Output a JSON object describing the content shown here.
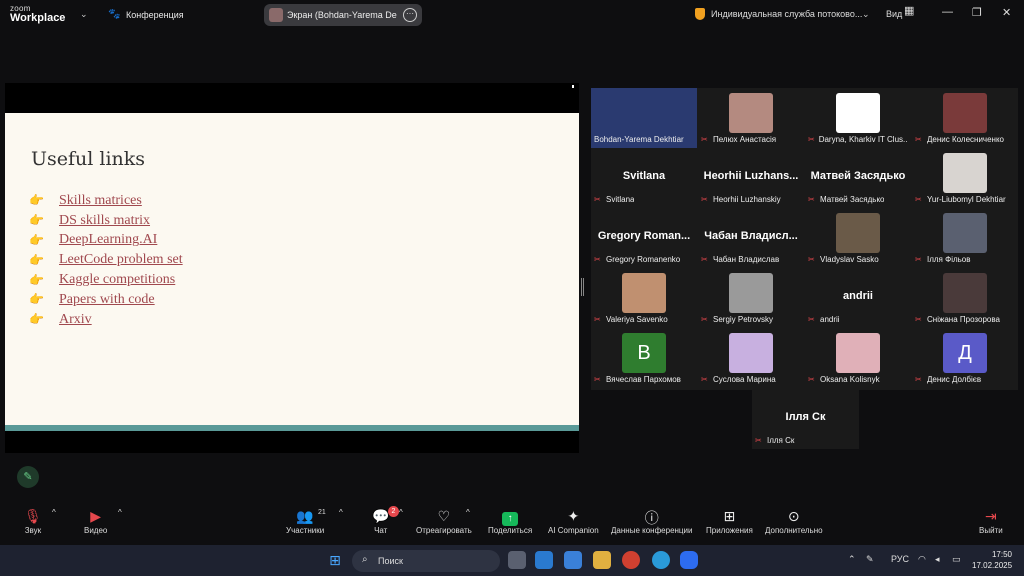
{
  "topbar": {
    "logo_top": "zoom",
    "logo_bottom": "Workplace",
    "meeting_label": "Конференция",
    "screen_share_label": "Экран (Bohdan-Yarema Dekhtiar",
    "security_label": "Индивидуальная служба потоково...",
    "view_label": "Вид"
  },
  "slide": {
    "title": "Useful links",
    "links": [
      "Skills matrices",
      "DS skills matrix",
      "DeepLearning.AI",
      "LeetCode problem set",
      "Kaggle competitions",
      "Papers with code",
      "Arxiv"
    ]
  },
  "gallery": {
    "tiles": [
      {
        "name": "Bohdan-Yarema Dekhtiar",
        "big": "",
        "pic": "#2a3a70",
        "muted": false
      },
      {
        "name": "Пелюх Анастасія",
        "big": "",
        "pic": "#b48a80",
        "muted": true
      },
      {
        "name": "Daryna, Kharkiv IT Clus...",
        "big": "",
        "pic": "#ffffff",
        "muted": true
      },
      {
        "name": "Денис Колесниченко",
        "big": "",
        "pic": "#7a3a3a",
        "muted": true
      },
      {
        "name": "Svitlana",
        "big": "Svitlana",
        "pic": "",
        "muted": true
      },
      {
        "name": "Heorhii Luzhanskiy",
        "big": "Heorhii  Luzhans...",
        "pic": "",
        "muted": true
      },
      {
        "name": "Матвей Засядько",
        "big": "Матвей Засядько",
        "pic": "",
        "muted": true
      },
      {
        "name": "Yur-Liubomyl Dekhtiar",
        "big": "",
        "pic": "#d8d4d0",
        "muted": true
      },
      {
        "name": "Gregory Romanenko",
        "big": "Gregory Roman...",
        "pic": "",
        "muted": true
      },
      {
        "name": "Чабан Владислав",
        "big": "Чабан  Владисл...",
        "pic": "",
        "muted": true
      },
      {
        "name": "Vladyslav Sasko",
        "big": "",
        "pic": "#6a5a48",
        "muted": true
      },
      {
        "name": "Ілля Фільов",
        "big": "",
        "pic": "#5a6070",
        "muted": true
      },
      {
        "name": "Valeriya Savenko",
        "big": "",
        "pic": "#c09070",
        "muted": true
      },
      {
        "name": "Sergiy Petrovsky",
        "big": "",
        "pic": "#9a9a9a",
        "muted": true
      },
      {
        "name": "andrii",
        "big": "andrii",
        "pic": "",
        "muted": true
      },
      {
        "name": "Сніжана Прозорова",
        "big": "",
        "pic": "#4a3a3a",
        "muted": true
      },
      {
        "name": "Вячеслав Пархомов",
        "big": "В",
        "pic": "#2f7d2f",
        "muted": true
      },
      {
        "name": "Суслова Марина",
        "big": "",
        "pic": "#c8b0e0",
        "muted": true
      },
      {
        "name": "Oksana Kolisnyk",
        "big": "",
        "pic": "#e0b0b8",
        "muted": true
      },
      {
        "name": "Денис Долбієв",
        "big": "Д",
        "pic": "#5a5ac8",
        "muted": true
      }
    ],
    "extra": {
      "name": "Ілля Ск",
      "big": "Ілля Ск"
    }
  },
  "toolbar": {
    "sound": "Звук",
    "video": "Видео",
    "participants": "Участники",
    "participants_count": "21",
    "chat": "Чат",
    "chat_badge": "2",
    "react": "Отреагировать",
    "share": "Поделиться",
    "ai": "AI Companion",
    "info": "Данные конференции",
    "apps": "Приложения",
    "more": "Дополнительно",
    "leave": "Выйти"
  },
  "taskbar": {
    "search_placeholder": "Поиск",
    "lang": "РУС",
    "time": "17:50",
    "date": "17.02.2025"
  },
  "colors": {
    "accent_green": "#16b85a",
    "muted_red": "#e5484d",
    "link": "#a0484e"
  }
}
